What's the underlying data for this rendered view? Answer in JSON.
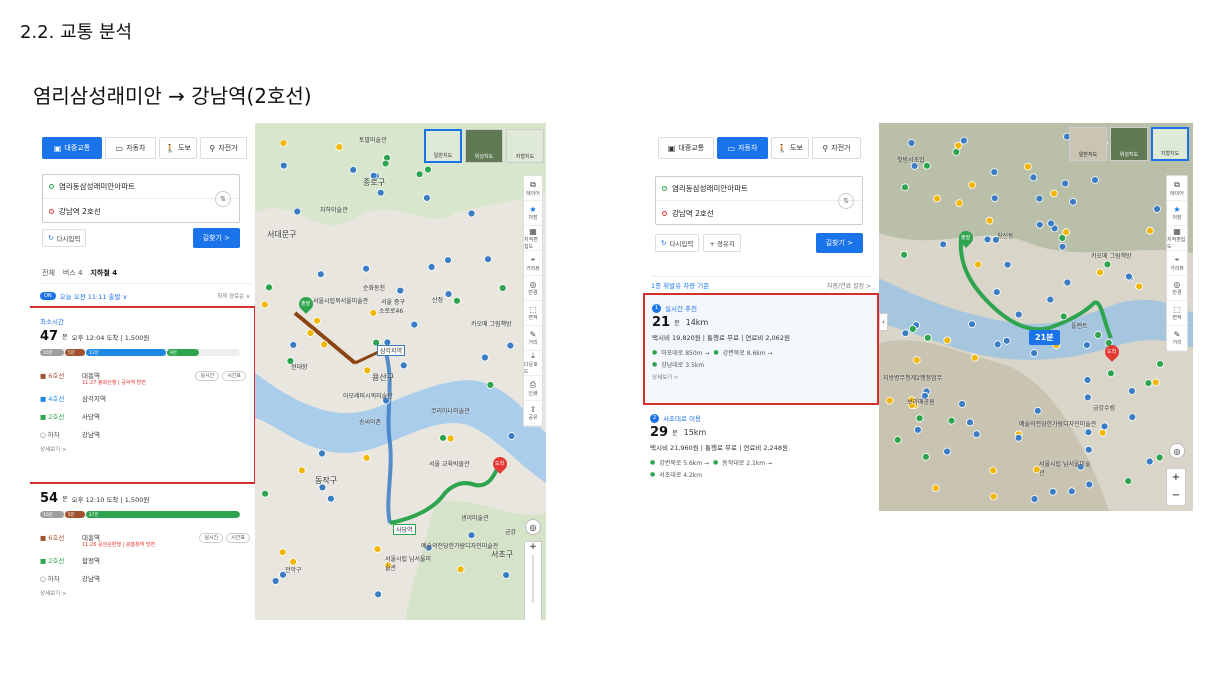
{
  "section_title": "2.2. 교통 분석",
  "route_title": "염리삼성래미안 → 강남역(2호선)",
  "left": {
    "modes": [
      {
        "icon": "bus-icon",
        "glyph": "🚌",
        "label": "대중교통",
        "active": true
      },
      {
        "icon": "car-icon",
        "glyph": "🚗",
        "label": "자동차",
        "active": false
      },
      {
        "icon": "walk-icon",
        "glyph": "🚶",
        "label": "도보",
        "active": false
      },
      {
        "icon": "bike-icon",
        "glyph": "🚲",
        "label": "자전거",
        "active": false
      }
    ],
    "origin": "염리동삼성래미안아파트",
    "destination": "강남역 2호선",
    "reset_label": "다시입력",
    "search_label": "길찾기 >",
    "tabs": [
      "전체",
      "버스 4",
      "지하철 4"
    ],
    "depart_badge": "ON",
    "depart_text": "오늘 오전 11:11 출발 ∨",
    "sort_text": "최적 경로순 ∨",
    "route1": {
      "tag": "최소시간",
      "minutes": "47",
      "unit": "분",
      "info": "오후 12:04 도착 | 1,500원",
      "bar": [
        {
          "label": "10분",
          "color": "#9e9e9e",
          "w": 12
        },
        {
          "label": "5분",
          "color": "#a0522d",
          "w": 10
        },
        {
          "label": "12분",
          "color": "#1e88e5",
          "w": 40
        },
        {
          "label": "9분",
          "color": "#2ea44f",
          "w": 16
        }
      ],
      "steps": [
        {
          "line": "6호선",
          "color": "#a0522d",
          "icon": "subway-icon",
          "station": "대흥역",
          "sub": "11:27 봉화산행 | 공덕역 방면",
          "pills": [
            "실시간",
            "시간표"
          ]
        },
        {
          "line": "4호선",
          "color": "#1e88e5",
          "icon": "subway-icon",
          "station": "삼각지역",
          "sub": "",
          "pills": []
        },
        {
          "line": "2호선",
          "color": "#2ea44f",
          "icon": "subway-icon",
          "station": "사당역",
          "sub": "",
          "pills": []
        },
        {
          "line": "하차",
          "color": "#555",
          "icon": "circle-icon",
          "station": "강남역",
          "sub": "",
          "pills": []
        }
      ],
      "more": "상세보기 >"
    },
    "route2": {
      "minutes": "54",
      "unit": "분",
      "info": "오후 12:10 도착 | 1,500원",
      "bar": [
        {
          "label": "10분",
          "color": "#9e9e9e",
          "w": 12
        },
        {
          "label": "5분",
          "color": "#a0522d",
          "w": 10
        },
        {
          "label": "37분",
          "color": "#2ea44f",
          "w": 78
        }
      ],
      "steps": [
        {
          "line": "6호선",
          "color": "#a0522d",
          "icon": "subway-icon",
          "station": "대흥역",
          "sub": "11:26 응암순환행 | 광흥창역 방면",
          "pills": [
            "실시간",
            "시간표"
          ]
        },
        {
          "line": "2호선",
          "color": "#2ea44f",
          "icon": "subway-icon",
          "station": "합정역",
          "sub": "",
          "pills": []
        },
        {
          "line": "하차",
          "color": "#555",
          "icon": "circle-icon",
          "station": "강남역",
          "sub": "",
          "pills": []
        }
      ],
      "more": "상세보기 >"
    },
    "map_thumbs": [
      "일반지도",
      "위성지도",
      "지형지도"
    ],
    "rail": [
      {
        "icon": "layers-icon",
        "g": "⧉",
        "t": "레이어"
      },
      {
        "icon": "star-icon",
        "g": "★",
        "t": "저장"
      },
      {
        "icon": "map-icon",
        "g": "▦",
        "t": "지적편집도"
      },
      {
        "icon": "pin-icon",
        "g": "⌖",
        "t": "거리뷰"
      },
      {
        "icon": "target-icon",
        "g": "◎",
        "t": "반경"
      },
      {
        "icon": "area-icon",
        "g": "⬚",
        "t": "면적"
      },
      {
        "icon": "ruler-icon",
        "g": "✎",
        "t": "거리"
      },
      {
        "icon": "download-icon",
        "g": "⤓",
        "t": "다운로드"
      },
      {
        "icon": "print-icon",
        "g": "⎙",
        "t": "인쇄"
      },
      {
        "icon": "share-icon",
        "g": "⇪",
        "t": "공유"
      }
    ],
    "map_labels": [
      {
        "t": "토말미술관"
      },
      {
        "t": "종로구"
      },
      {
        "t": "자하미술관"
      },
      {
        "t": "서대문구"
      },
      {
        "t": "서울시립북서울미술관"
      },
      {
        "t": "순화동천"
      },
      {
        "t": "서울 중구"
      },
      {
        "t": "소로로46"
      },
      {
        "t": "산정"
      },
      {
        "t": "삼각지역"
      },
      {
        "t": "용산구"
      },
      {
        "t": "카오메 그림책방"
      },
      {
        "t": "아모레퍼시픽미술관"
      },
      {
        "t": "송씨이촌"
      },
      {
        "t": "코리아나미술관"
      },
      {
        "t": "동작구"
      },
      {
        "t": "서울 교육박물관"
      },
      {
        "t": "사당역"
      },
      {
        "t": "생이미술관"
      },
      {
        "t": "예술의전당한가람디자인미술관"
      },
      {
        "t": "서울시립 남서울미술관"
      },
      {
        "t": "관악구"
      },
      {
        "t": "서초구"
      },
      {
        "t": "출발"
      },
      {
        "t": "도착"
      },
      {
        "t": "현대장"
      },
      {
        "t": "금강"
      }
    ]
  },
  "right": {
    "modes": [
      {
        "icon": "bus-icon",
        "glyph": "🚌",
        "label": "대중교통",
        "active": false
      },
      {
        "icon": "car-icon",
        "glyph": "🚗",
        "label": "자동차",
        "active": true
      },
      {
        "icon": "walk-icon",
        "glyph": "🚶",
        "label": "도보",
        "active": false
      },
      {
        "icon": "bike-icon",
        "glyph": "🚲",
        "label": "자전거",
        "active": false
      }
    ],
    "origin": "염리동삼성래미안아파트",
    "destination": "강남역 2호선",
    "reset_label": "다시입력",
    "waypoint_label": "+ 경유지",
    "search_label": "길찾기 >",
    "fuel_text": "1종 휘발유 차량 기준",
    "setting_text": "차종/연료 설정 >",
    "route1": {
      "tag": "실시간 추천",
      "num": "1",
      "minutes": "21",
      "unit": "분",
      "distance": "14km",
      "fees": "택시비 19,820원 | 통행료 무료 | 연료비 2,062원",
      "roads": [
        [
          "마포대로 850m →",
          "강변북로 8.6km →"
        ],
        [
          "강남대로 3.5km"
        ]
      ],
      "more": "상세보기 >"
    },
    "route2": {
      "tag": "서초대로 이용",
      "num": "2",
      "minutes": "29",
      "unit": "분",
      "distance": "15km",
      "fees": "택시비 21,960원 | 통행료 무료 | 연료비 2,248원",
      "roads": [
        [
          "강변북로 5.6km →",
          "동작대로 2.1km →"
        ],
        [
          "서초대로 4.2km"
        ]
      ]
    },
    "map_thumbs": [
      "일반지도",
      "위성지도",
      "지형지도"
    ],
    "rail": [
      {
        "icon": "layers-icon",
        "g": "⧉",
        "t": "레이어"
      },
      {
        "icon": "star-icon",
        "g": "★",
        "t": "저장"
      },
      {
        "icon": "map-icon",
        "g": "▦",
        "t": "지적편집도"
      },
      {
        "icon": "pin-icon",
        "g": "⌖",
        "t": "거리뷰"
      },
      {
        "icon": "target-icon",
        "g": "◎",
        "t": "반경"
      },
      {
        "icon": "area-icon",
        "g": "⬚",
        "t": "면적"
      },
      {
        "icon": "ruler-icon",
        "g": "✎",
        "t": "거리"
      }
    ],
    "time_badge": "21분",
    "map_labels": [
      {
        "t": "첫방서초밥"
      },
      {
        "t": "창신동"
      },
      {
        "t": "플랜트"
      },
      {
        "t": "카오메 그림책방"
      },
      {
        "t": "지방병무청제2행정업무"
      },
      {
        "t": "보라매공원"
      },
      {
        "t": "예술의전당한가람디자인미술관"
      },
      {
        "t": "서울시립 남서울미술관"
      },
      {
        "t": "금강수림"
      },
      {
        "t": "출발"
      },
      {
        "t": "도착"
      }
    ]
  }
}
